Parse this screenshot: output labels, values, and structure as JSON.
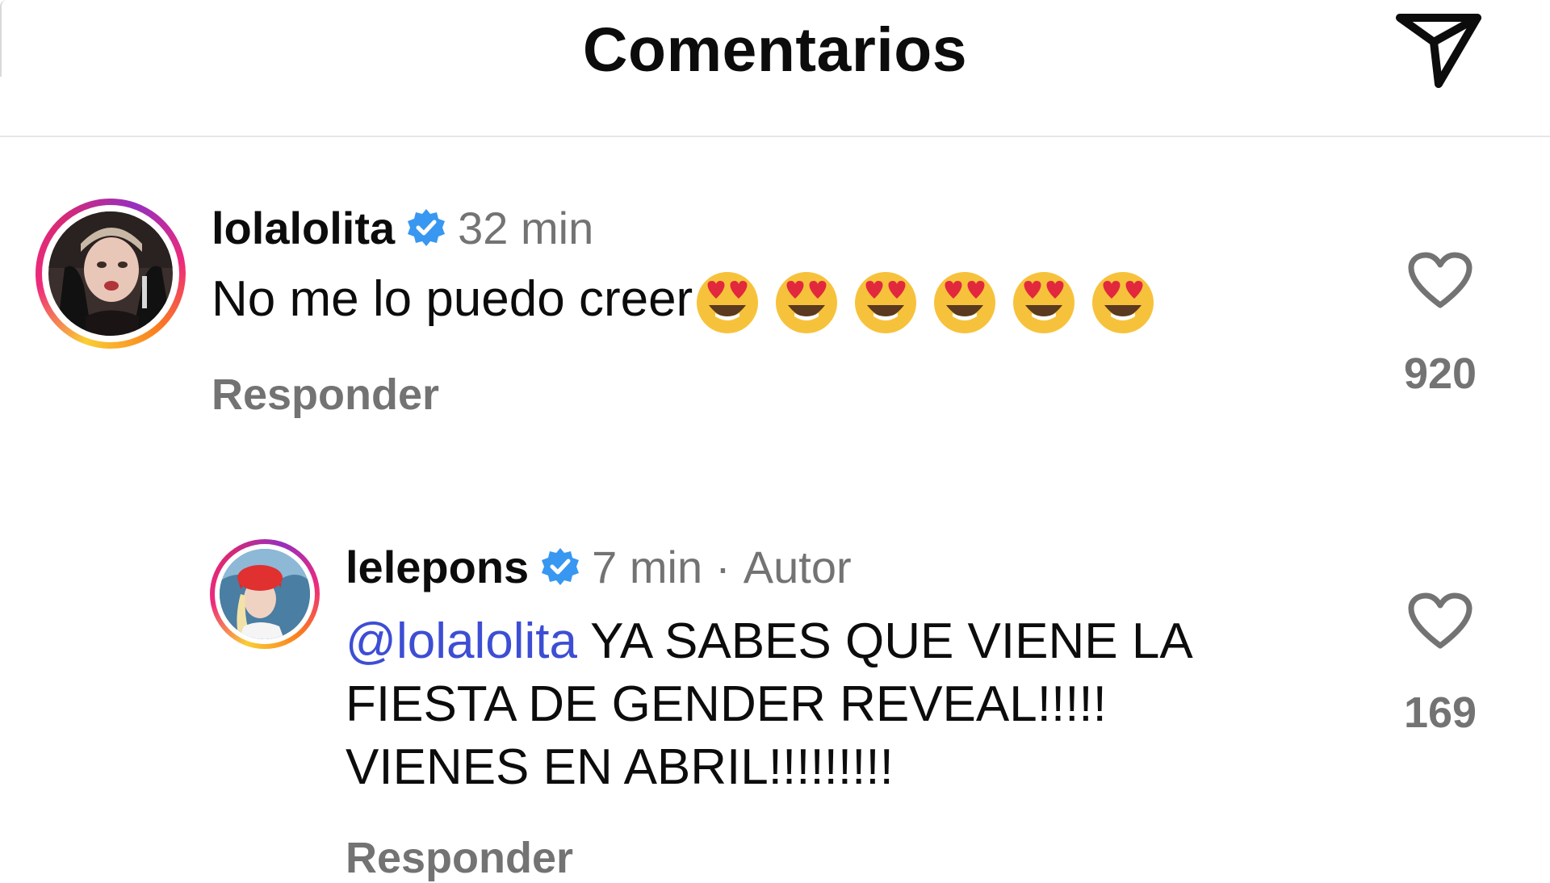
{
  "header": {
    "title": "Comentarios",
    "share_icon": "paper-plane-send-icon"
  },
  "comments": [
    {
      "username": "lolalolita",
      "verified": true,
      "time": "32 min",
      "text": "No me lo puedo creer",
      "emojis": [
        "heart-eyes-emoji",
        "heart-eyes-emoji",
        "heart-eyes-emoji",
        "heart-eyes-emoji",
        "heart-eyes-emoji",
        "heart-eyes-emoji"
      ],
      "reply_label": "Responder",
      "likes": "920"
    }
  ],
  "replies": [
    {
      "username": "lelepons",
      "verified": true,
      "time": "7 min",
      "separator": "·",
      "author_badge": "Autor",
      "mention": "@lolalolita",
      "text_line1": " YA SABES QUE VIENE LA",
      "text_line2": "FIESTA DE GENDER REVEAL!!!!!",
      "text_line3": "VIENES EN ABRIL!!!!!!!!!",
      "reply_label": "Responder",
      "likes": "169"
    }
  ],
  "colors": {
    "text_primary": "#0c0c0c",
    "text_secondary": "#737373",
    "mention": "#3d4ed4",
    "verified_badge": "#3897f0",
    "divider": "#e6e6e6"
  }
}
